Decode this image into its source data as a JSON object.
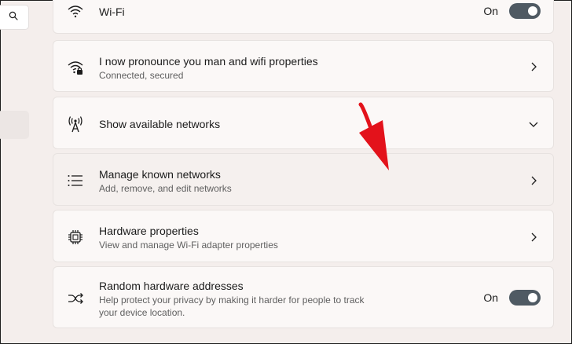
{
  "sidebar": {
    "search_icon": "search-icon"
  },
  "wifi": {
    "title": "Wi-Fi",
    "toggle_label": "On",
    "icon": "wifi-icon"
  },
  "network": {
    "title": "I now pronounce you man and wifi properties",
    "subtitle": "Connected, secured",
    "icon": "wifi-secured-icon"
  },
  "available": {
    "title": "Show available networks",
    "icon": "antenna-icon"
  },
  "known": {
    "title": "Manage known networks",
    "subtitle": "Add, remove, and edit networks",
    "icon": "list-icon"
  },
  "hardware": {
    "title": "Hardware properties",
    "subtitle": "View and manage Wi-Fi adapter properties",
    "icon": "chip-icon"
  },
  "random": {
    "title": "Random hardware addresses",
    "subtitle": "Help protect your privacy by making it harder for people to track your device location.",
    "toggle_label": "On",
    "icon": "shuffle-icon"
  },
  "colors": {
    "toggle_on": "#4f5a63",
    "annotation_arrow": "#e3121b"
  }
}
